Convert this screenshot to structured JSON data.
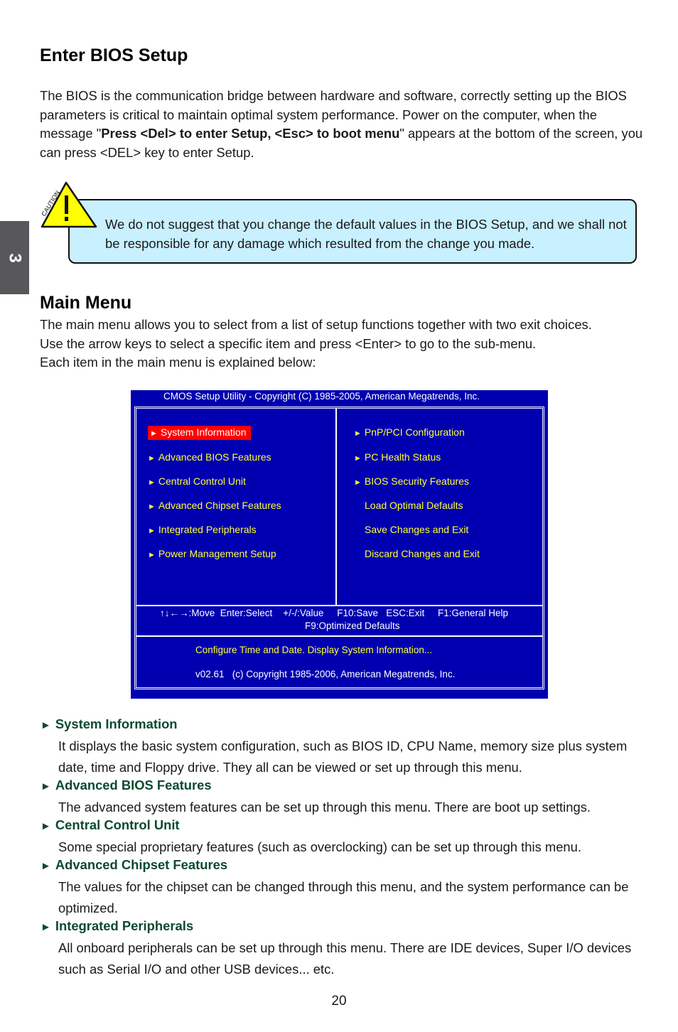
{
  "chapter_tab": "3",
  "section1": {
    "title": "Enter BIOS Setup",
    "para_before": "The BIOS is the communication bridge between hardware and software, correctly setting up the BIOS parameters is critical to maintain optimal system performance. Power on the computer, when the message \"",
    "para_bold": "Press <Del> to enter Setup, <Esc> to boot menu",
    "para_after": "\" appears at the bottom of the screen, you can press <DEL> key to enter Setup."
  },
  "caution": {
    "icon_label": "CAUTION",
    "text": "We do not suggest that you change the default values in the BIOS Setup, and we shall not be responsible for any damage which resulted from the change you made."
  },
  "section2": {
    "title": "Main Menu",
    "lines": [
      "The main menu allows you to select from a list of setup functions together with two exit choices.",
      "Use the arrow keys to select a specific item and press <Enter> to go to the sub-menu.",
      "Each item in the main menu is explained below:"
    ]
  },
  "bios_screen": {
    "title": "CMOS Setup Utility - Copyright (C) 1985-2005, American Megatrends, Inc.",
    "left_menu": [
      {
        "label": "System Information",
        "arrow": true,
        "selected": true
      },
      {
        "label": "Advanced BIOS Features",
        "arrow": true,
        "selected": false
      },
      {
        "label": "Central Control Unit",
        "arrow": true,
        "selected": false
      },
      {
        "label": "Advanced Chipset Features",
        "arrow": true,
        "selected": false
      },
      {
        "label": "Integrated Peripherals",
        "arrow": true,
        "selected": false
      },
      {
        "label": "Power Management Setup",
        "arrow": true,
        "selected": false
      }
    ],
    "right_menu": [
      {
        "label": "PnP/PCI Configuration",
        "arrow": true
      },
      {
        "label": "PC Health Status",
        "arrow": true
      },
      {
        "label": "BIOS Security Features",
        "arrow": true
      },
      {
        "label": "Load Optimal Defaults",
        "arrow": false
      },
      {
        "label": "Save Changes and Exit",
        "arrow": false
      },
      {
        "label": "Discard Changes and Exit",
        "arrow": false
      }
    ],
    "arrow_glyph": "►",
    "keys_line1": "↑↓←→:Move  Enter:Select    +/-/:Value     F10:Save   ESC:Exit     F1:General Help",
    "keys_line2": "F9:Optimized Defaults",
    "help_text": "Configure Time and Date.  Display System Information...",
    "version_text": "v02.61   (c) Copyright 1985-2006, American Megatrends, Inc.",
    "colors": {
      "background": "#0000b0",
      "item": "#ffff33",
      "selected_bg": "#ff0000",
      "text": "#ffffff"
    }
  },
  "descriptions": [
    {
      "heading": "System Information",
      "body": "It displays the basic system configuration, such as BIOS ID, CPU Name, memory size plus system date, time and Floppy drive. They all can be viewed or set up through this menu."
    },
    {
      "heading": "Advanced BIOS Features",
      "body": "The advanced system features can be set up through this menu. There are boot up settings."
    },
    {
      "heading": "Central Control Unit",
      "body": "Some special proprietary features (such as overclocking) can be set up through this menu."
    },
    {
      "heading": "Advanced Chipset Features",
      "body": "The values for the chipset can be changed through this menu, and the system performance can be optimized."
    },
    {
      "heading": "Integrated Peripherals",
      "body": "All onboard peripherals can be set up through this menu. There are IDE devices, Super I/O devices such as Serial I/O and other USB devices... etc."
    }
  ],
  "heading_color": "#0d4a2f",
  "page_number": "20"
}
